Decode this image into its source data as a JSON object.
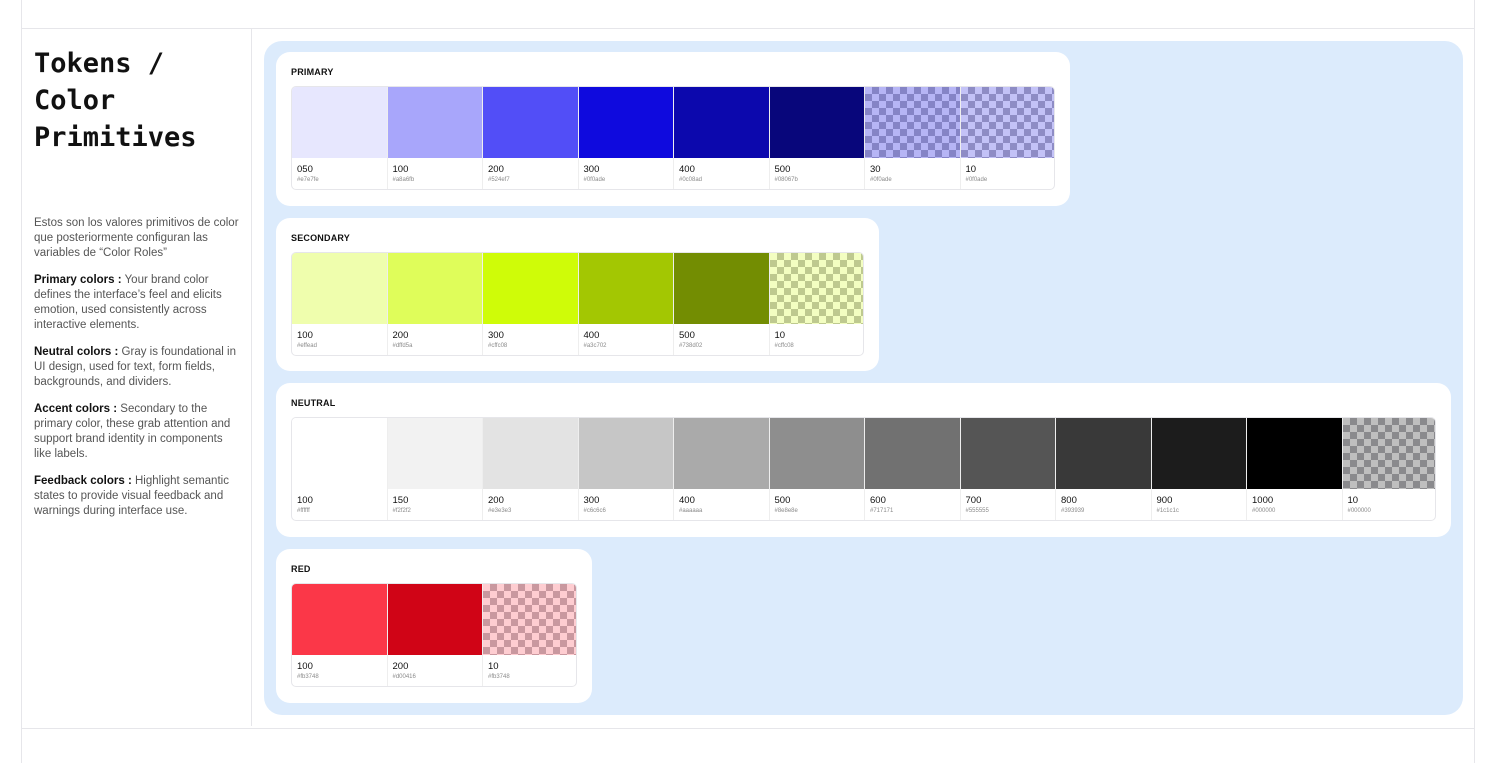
{
  "sidebar": {
    "title": "Tokens / Color Primitives",
    "intro": "Estos son los valores primitivos de color que posteriormente configuran las variables de “Color Roles”",
    "sections": [
      {
        "label": "Primary colors :",
        "text": " Your brand color defines the interface’s feel and elicits emotion, used consistently across interactive elements."
      },
      {
        "label": "Neutral colors :",
        "text": " Gray is foundational in UI design, used for text, form fields, backgrounds, and dividers."
      },
      {
        "label": "Accent colors :",
        "text": "  Secondary to the primary color, these grab attention and support brand identity in components like labels."
      },
      {
        "label": "Feedback colors :",
        "text": "  Highlight semantic states to provide visual feedback and warnings during interface use."
      }
    ]
  },
  "palettes": {
    "primary": {
      "title": "PRIMARY",
      "swatches": [
        {
          "step": "050",
          "hex": "#e7e7fe",
          "color": "#e7e7fe"
        },
        {
          "step": "100",
          "hex": "#a8a6fb",
          "color": "#a8a6fb"
        },
        {
          "step": "200",
          "hex": "#524ef7",
          "color": "#524ef7"
        },
        {
          "step": "300",
          "hex": "#0f0ade",
          "color": "#0f0ade"
        },
        {
          "step": "400",
          "hex": "#0c08ad",
          "color": "#0c08ad"
        },
        {
          "step": "500",
          "hex": "#08067b",
          "color": "#08067b"
        },
        {
          "step": "30",
          "hex": "#0f0ade",
          "color": "#0f0ade",
          "alpha": 0.3
        },
        {
          "step": "10",
          "hex": "#0f0ade",
          "color": "#0f0ade",
          "alpha": 0.1
        }
      ]
    },
    "secondary": {
      "title": "SECONDARY",
      "swatches": [
        {
          "step": "100",
          "hex": "#effead",
          "color": "#effead"
        },
        {
          "step": "200",
          "hex": "#dffd5a",
          "color": "#dffd5a"
        },
        {
          "step": "300",
          "hex": "#cffc08",
          "color": "#cffc08"
        },
        {
          "step": "400",
          "hex": "#a3c702",
          "color": "#a3c702"
        },
        {
          "step": "500",
          "hex": "#738d02",
          "color": "#738d02"
        },
        {
          "step": "10",
          "hex": "#cffc08",
          "color": "#cffc08",
          "alpha": 0.1
        }
      ]
    },
    "neutral": {
      "title": "NEUTRAL",
      "swatches": [
        {
          "step": "100",
          "hex": "#ffffff",
          "color": "#ffffff"
        },
        {
          "step": "150",
          "hex": "#f2f2f2",
          "color": "#f2f2f2"
        },
        {
          "step": "200",
          "hex": "#e3e3e3",
          "color": "#e3e3e3"
        },
        {
          "step": "300",
          "hex": "#c6c6c6",
          "color": "#c6c6c6"
        },
        {
          "step": "400",
          "hex": "#aaaaaa",
          "color": "#aaaaaa"
        },
        {
          "step": "500",
          "hex": "#8e8e8e",
          "color": "#8e8e8e"
        },
        {
          "step": "600",
          "hex": "#717171",
          "color": "#717171"
        },
        {
          "step": "700",
          "hex": "#555555",
          "color": "#555555"
        },
        {
          "step": "800",
          "hex": "#393939",
          "color": "#393939"
        },
        {
          "step": "900",
          "hex": "#1c1c1c",
          "color": "#1c1c1c"
        },
        {
          "step": "1000",
          "hex": "#000000",
          "color": "#000000"
        },
        {
          "step": "10",
          "hex": "#000000",
          "color": "#000000",
          "alpha": 0.1
        }
      ]
    },
    "red": {
      "title": "RED",
      "swatches": [
        {
          "step": "100",
          "hex": "#fb3748",
          "color": "#fb3748"
        },
        {
          "step": "200",
          "hex": "#d00416",
          "color": "#d00416"
        },
        {
          "step": "10",
          "hex": "#fb3748",
          "color": "#fb3748",
          "alpha": 0.1
        }
      ]
    }
  }
}
